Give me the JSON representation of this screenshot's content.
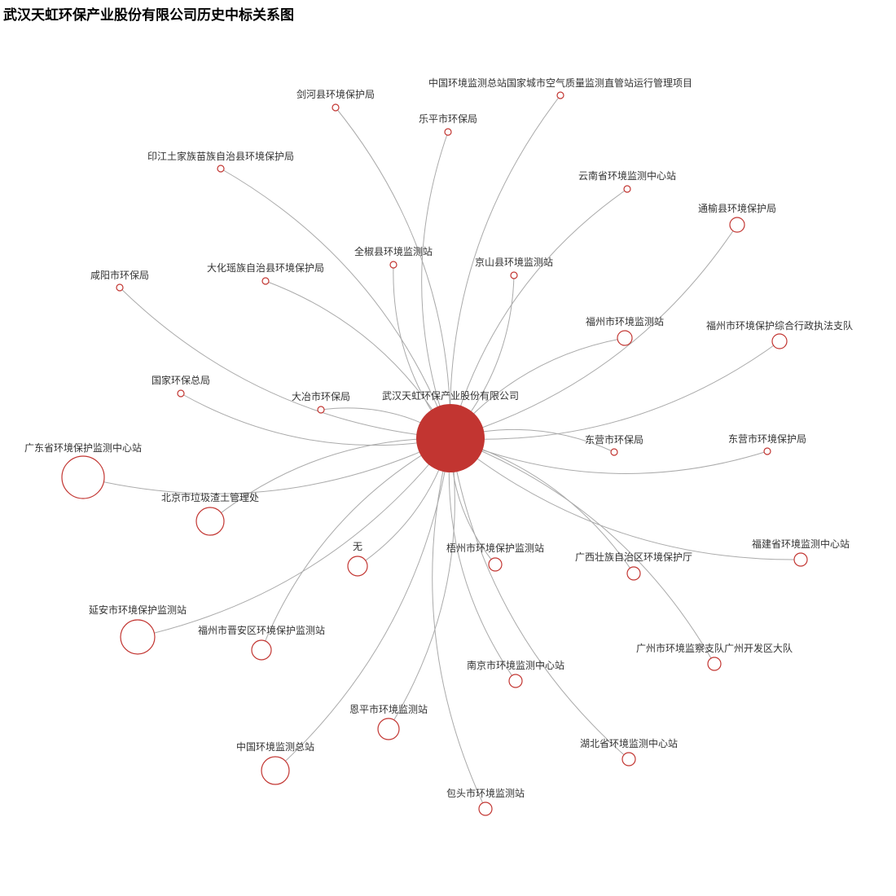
{
  "title": "武汉天虹环保产业股份有限公司历史中标关系图",
  "colors": {
    "node_fill": "#c23531",
    "node_stroke": "#c23531",
    "leaf_fill": "#ffffff",
    "edge": "#aaaaaa"
  },
  "center": {
    "label": "武汉天虹环保产业股份有限公司"
  },
  "nodes": [
    {
      "label": "中国环境监测总站国家城市空气质量监测直管站运行管理项目"
    },
    {
      "label": "剑河县环境保护局"
    },
    {
      "label": "乐平市环保局"
    },
    {
      "label": "印江土家族苗族自治县环境保护局"
    },
    {
      "label": "云南省环境监测中心站"
    },
    {
      "label": "通榆县环境保护局"
    },
    {
      "label": "全椒县环境监测站"
    },
    {
      "label": "京山县环境监测站"
    },
    {
      "label": "咸阳市环保局"
    },
    {
      "label": "大化瑶族自治县环境保护局"
    },
    {
      "label": "福州市环境监测站"
    },
    {
      "label": "福州市环境保护综合行政执法支队"
    },
    {
      "label": "国家环保总局"
    },
    {
      "label": "大冶市环保局"
    },
    {
      "label": "东营市环保局"
    },
    {
      "label": "东营市环境保护局"
    },
    {
      "label": "广东省环境保护监测中心站"
    },
    {
      "label": "北京市垃圾渣土管理处"
    },
    {
      "label": "无"
    },
    {
      "label": "梧州市环境保护监测站"
    },
    {
      "label": "广西壮族自治区环境保护厅"
    },
    {
      "label": "福建省环境监测中心站"
    },
    {
      "label": "延安市环境保护监测站"
    },
    {
      "label": "福州市晋安区环境保护监测站"
    },
    {
      "label": "广州市环境监察支队广州开发区大队"
    },
    {
      "label": "南京市环境监测中心站"
    },
    {
      "label": "恩平市环境监测站"
    },
    {
      "label": "湖北省环境监测中心站"
    },
    {
      "label": "中国环境监测总站"
    },
    {
      "label": "包头市环境监测站"
    }
  ]
}
